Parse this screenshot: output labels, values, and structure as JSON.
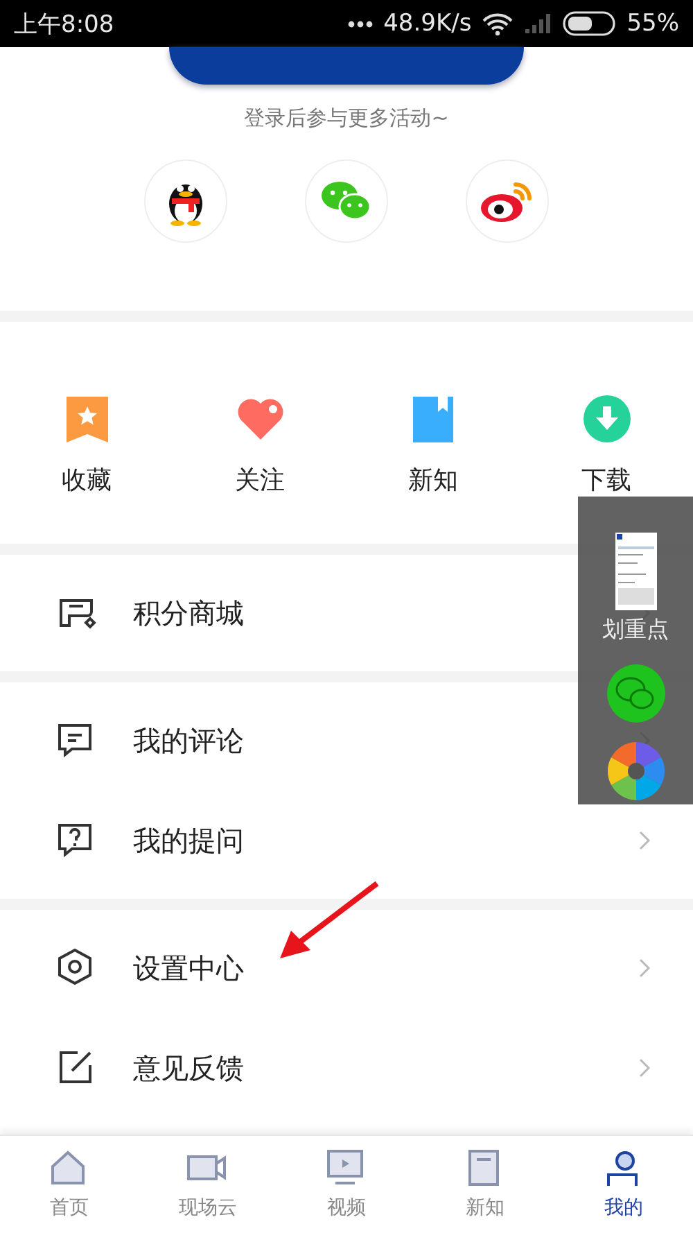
{
  "status_bar": {
    "time": "上午8:08",
    "speed": "48.9K/s",
    "battery": "55%"
  },
  "login": {
    "subtitle": "登录后参与更多活动~",
    "socials": [
      {
        "kind": "qq"
      },
      {
        "kind": "wechat"
      },
      {
        "kind": "weibo"
      }
    ]
  },
  "quick_actions": [
    {
      "label": "收藏",
      "kind": "favorite"
    },
    {
      "label": "关注",
      "kind": "follow"
    },
    {
      "label": "新知",
      "kind": "book"
    },
    {
      "label": "下载",
      "kind": "download"
    }
  ],
  "menu_groups": [
    [
      {
        "label": "积分商城",
        "kind": "store"
      }
    ],
    [
      {
        "label": "我的评论",
        "kind": "comment"
      },
      {
        "label": "我的提问",
        "kind": "question"
      }
    ],
    [
      {
        "label": "设置中心",
        "kind": "settings"
      },
      {
        "label": "意见反馈",
        "kind": "feedback"
      }
    ]
  ],
  "floating_panel": {
    "label": "划重点"
  },
  "bottom_nav": [
    {
      "label": "首页",
      "kind": "home",
      "selected": false
    },
    {
      "label": "现场云",
      "kind": "video",
      "selected": false
    },
    {
      "label": "视频",
      "kind": "tv",
      "selected": false
    },
    {
      "label": "新知",
      "kind": "book",
      "selected": false
    },
    {
      "label": "我的",
      "kind": "user",
      "selected": true
    }
  ]
}
